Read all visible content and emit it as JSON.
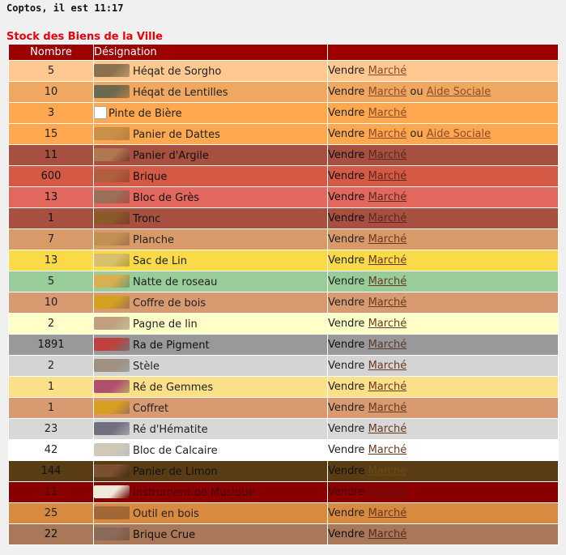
{
  "header": {
    "city_time": "Coptos, il est 11:17"
  },
  "title": "Stock des Biens de la Ville",
  "columns": {
    "nombre": "Nombre",
    "designation": "Désignation",
    "actions": ""
  },
  "labels": {
    "vendre": "Vendre",
    "marche": "Marché",
    "ou": "ou",
    "aide": "Aide Sociale"
  },
  "rows": [
    {
      "n": "5",
      "name": "Héqat de Sorgho",
      "bg": "#ffc890",
      "tc": "#222222",
      "lc": "#8b4a2a",
      "aide": false,
      "icon": "sorghum-icon",
      "ic": "#8a7250"
    },
    {
      "n": "10",
      "name": "Héqat de Lentilles",
      "bg": "#f0a860",
      "tc": "#222222",
      "lc": "#8b4a2a",
      "aide": true,
      "icon": "lentils-icon",
      "ic": "#6a6a50"
    },
    {
      "n": "3",
      "name": "Pinte de Bière",
      "bg": "#ffa850",
      "tc": "#222222",
      "lc": "#8b4a2a",
      "aide": false,
      "icon": "broken-image-icon",
      "ic": "",
      "broken": true
    },
    {
      "n": "15",
      "name": "Panier de Dattes",
      "bg": "#ffa850",
      "tc": "#222222",
      "lc": "#8b4a2a",
      "aide": true,
      "icon": "dates-basket-icon",
      "ic": "#c89048"
    },
    {
      "n": "11",
      "name": "Panier d'Argile",
      "bg": "#a85040",
      "tc": "#111111",
      "lc": "#5a2a20",
      "aide": false,
      "icon": "clay-basket-icon",
      "ic": "#b07850"
    },
    {
      "n": "600",
      "name": "Brique",
      "bg": "#d55a45",
      "tc": "#111111",
      "lc": "#5a2a20",
      "aide": false,
      "icon": "brick-icon",
      "ic": "#b06040"
    },
    {
      "n": "13",
      "name": "Bloc de Grès",
      "bg": "#e2685e",
      "tc": "#111111",
      "lc": "#5a2a20",
      "aide": false,
      "icon": "sandstone-icon",
      "ic": "#9a7058"
    },
    {
      "n": "1",
      "name": "Tronc",
      "bg": "#a85040",
      "tc": "#111111",
      "lc": "#5a2a20",
      "aide": false,
      "icon": "log-icon",
      "ic": "#8a5a28"
    },
    {
      "n": "7",
      "name": "Planche",
      "bg": "#d89a68",
      "tc": "#222222",
      "lc": "#6a3a20",
      "aide": false,
      "icon": "plank-icon",
      "ic": "#c09050"
    },
    {
      "n": "13",
      "name": "Sac de Lin",
      "bg": "#fada48",
      "tc": "#222222",
      "lc": "#6a3a20",
      "aide": false,
      "icon": "linen-sack-icon",
      "ic": "#d8c070"
    },
    {
      "n": "5",
      "name": "Natte de roseau",
      "bg": "#98cc98",
      "tc": "#222222",
      "lc": "#6a3a20",
      "aide": false,
      "icon": "reed-mat-icon",
      "ic": "#d8b050"
    },
    {
      "n": "10",
      "name": "Coffre de bois",
      "bg": "#d89a70",
      "tc": "#222222",
      "lc": "#6a3a20",
      "aide": false,
      "icon": "wood-chest-icon",
      "ic": "#d4a020"
    },
    {
      "n": "2",
      "name": "Pagne de lin",
      "bg": "#ffffc8",
      "tc": "#222222",
      "lc": "#6a3a20",
      "aide": false,
      "icon": "loincloth-icon",
      "ic": "#c0a080"
    },
    {
      "n": "1891",
      "name": "Ra de Pigment",
      "bg": "#999999",
      "tc": "#111111",
      "lc": "#5a3a30",
      "aide": false,
      "icon": "pigment-icon",
      "ic": "#c04040"
    },
    {
      "n": "2",
      "name": "Stèle",
      "bg": "#d4d4d4",
      "tc": "#222222",
      "lc": "#6a3a20",
      "aide": false,
      "icon": "stele-icon",
      "ic": "#a09080"
    },
    {
      "n": "1",
      "name": "Ré de Gemmes",
      "bg": "#fae088",
      "tc": "#222222",
      "lc": "#6a3a20",
      "aide": false,
      "icon": "gems-icon",
      "ic": "#b05070"
    },
    {
      "n": "1",
      "name": "Coffret",
      "bg": "#d89a70",
      "tc": "#222222",
      "lc": "#6a3a20",
      "aide": false,
      "icon": "casket-icon",
      "ic": "#d8a020"
    },
    {
      "n": "23",
      "name": "Ré d'Hématite",
      "bg": "#d8d8d8",
      "tc": "#222222",
      "lc": "#6a3a20",
      "aide": false,
      "icon": "hematite-icon",
      "ic": "#707080"
    },
    {
      "n": "42",
      "name": "Bloc de Calcaire",
      "bg": "#ffffff",
      "tc": "#222222",
      "lc": "#6a3a20",
      "aide": false,
      "icon": "limestone-icon",
      "ic": "#d0c8b8"
    },
    {
      "n": "144",
      "name": "Panier de Limon",
      "bg": "#5a3c14",
      "tc": "#111111",
      "lc": "#6a4a18",
      "aide": false,
      "icon": "silt-basket-icon",
      "ic": "#7a5030"
    },
    {
      "n": "11",
      "name": "Instrument de Musique",
      "bg": "#8a0000",
      "tc": "#4a0000",
      "lc": "#6a1010",
      "aide": false,
      "icon": "music-instrument-icon",
      "ic": "#f0e8d8"
    },
    {
      "n": "25",
      "name": "Outil en bois",
      "bg": "#d88a40",
      "tc": "#222222",
      "lc": "#6a3a20",
      "aide": false,
      "icon": "wood-tool-icon",
      "ic": "#a06838"
    },
    {
      "n": "22",
      "name": "Brique Crue",
      "bg": "#a87858",
      "tc": "#111111",
      "lc": "#5a2a20",
      "aide": false,
      "icon": "mud-brick-icon",
      "ic": "#8a6a58"
    }
  ]
}
